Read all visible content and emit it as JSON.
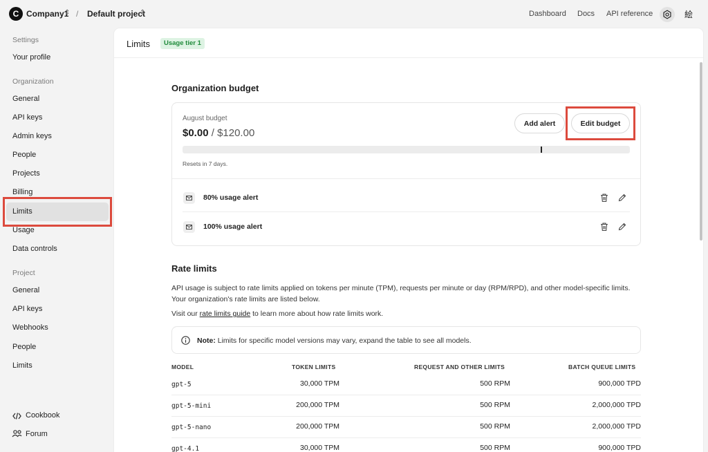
{
  "topbar": {
    "org_initial": "C",
    "org_name": "Company1",
    "separator": "/",
    "project_name": "Default project",
    "links": [
      "Dashboard",
      "Docs",
      "API reference"
    ],
    "user_initial": "絵"
  },
  "sidebar": {
    "settings_header": "Settings",
    "your_profile": "Your profile",
    "org_header": "Organization",
    "org_items": [
      "General",
      "API keys",
      "Admin keys",
      "People",
      "Projects",
      "Billing",
      "Limits",
      "Usage",
      "Data controls"
    ],
    "active_item": "Limits",
    "project_header": "Project",
    "project_items": [
      "General",
      "API keys",
      "Webhooks",
      "People",
      "Limits"
    ],
    "cookbook": "Cookbook",
    "forum": "Forum"
  },
  "page": {
    "title": "Limits",
    "tier_badge": "Usage tier 1"
  },
  "budget": {
    "heading": "Organization budget",
    "period_label": "August budget",
    "spent": "$0.00",
    "separator": " / ",
    "total": "$120.00",
    "add_alert": "Add alert",
    "edit_budget": "Edit budget",
    "progress_fraction": 0.0,
    "threshold_fraction": 0.8,
    "resets": "Resets in 7 days.",
    "alerts": [
      "80% usage alert",
      "100% usage alert"
    ]
  },
  "rate_limits": {
    "heading": "Rate limits",
    "intro_line1": "API usage is subject to rate limits applied on tokens per minute (TPM), requests per minute or day (RPM/RPD), and other model-specific limits.",
    "intro_line2": "Your organization's rate limits are listed below.",
    "visit_prefix": "Visit our ",
    "visit_link": "rate limits guide",
    "visit_suffix": " to learn more about how rate limits work.",
    "note_label": "Note:",
    "note_text": " Limits for specific model versions may vary, expand the table to see all models.",
    "columns": [
      "MODEL",
      "TOKEN LIMITS",
      "REQUEST AND OTHER LIMITS",
      "BATCH QUEUE LIMITS"
    ],
    "rows": [
      {
        "model": "gpt-5",
        "tokens": "30,000 TPM",
        "requests": "500 RPM",
        "batch": "900,000 TPD"
      },
      {
        "model": "gpt-5-mini",
        "tokens": "200,000 TPM",
        "requests": "500 RPM",
        "batch": "2,000,000 TPD"
      },
      {
        "model": "gpt-5-nano",
        "tokens": "200,000 TPM",
        "requests": "500 RPM",
        "batch": "2,000,000 TPD"
      },
      {
        "model": "gpt-4.1",
        "tokens": "30,000 TPM",
        "requests": "500 RPM",
        "batch": "900,000 TPD"
      }
    ]
  }
}
